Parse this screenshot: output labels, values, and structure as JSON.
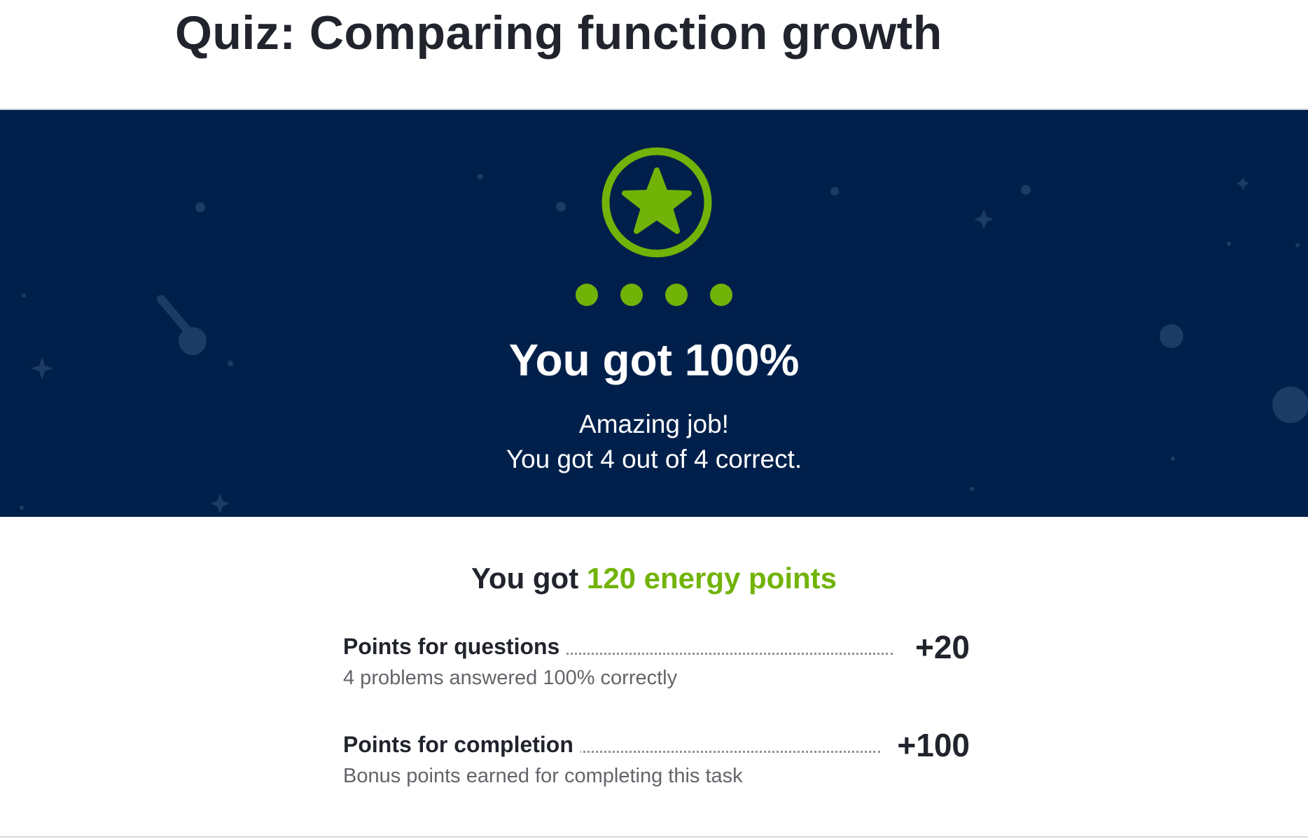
{
  "page": {
    "title": "Quiz: Comparing function growth"
  },
  "result": {
    "badge_icon": "star-badge-icon",
    "progress_dots": [
      {
        "status": "correct"
      },
      {
        "status": "correct"
      },
      {
        "status": "correct"
      },
      {
        "status": "correct"
      }
    ],
    "heading": "You got 100%",
    "praise": "Amazing job!",
    "summary": "You got 4 out of 4 correct."
  },
  "points": {
    "prefix": "You got ",
    "total": "120 energy points",
    "rows": [
      {
        "label": "Points for questions",
        "value": "+20",
        "description": "4 problems answered 100% correctly"
      },
      {
        "label": "Points for completion",
        "value": "+100",
        "description": "Bonus points earned for completing this task"
      }
    ]
  },
  "colors": {
    "banner_background": "#00204b",
    "accent_green": "#71b307",
    "text_dark": "#21242c",
    "text_muted": "#626569"
  }
}
